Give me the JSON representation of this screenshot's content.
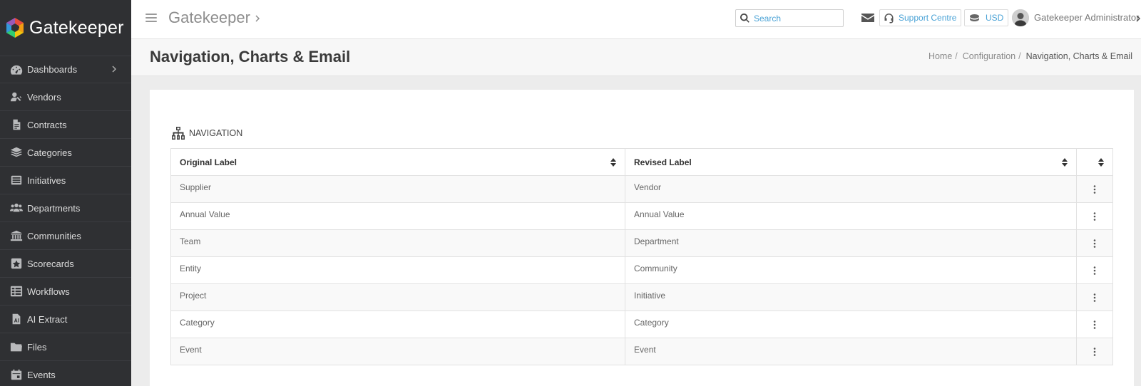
{
  "app": {
    "name": "Gatekeeper",
    "title": "Gatekeeper"
  },
  "colors": {
    "sidebar_bg": "#2f3033",
    "link": "#4ba3d6",
    "row_alt": "#f9f9f9"
  },
  "sidebar": {
    "items": [
      {
        "label": "Dashboards",
        "icon": "dashboard-icon",
        "has_submenu": true
      },
      {
        "label": "Vendors",
        "icon": "vendors-icon"
      },
      {
        "label": "Contracts",
        "icon": "contract-icon"
      },
      {
        "label": "Categories",
        "icon": "layers-icon"
      },
      {
        "label": "Initiatives",
        "icon": "initiatives-icon"
      },
      {
        "label": "Departments",
        "icon": "users-icon"
      },
      {
        "label": "Communities",
        "icon": "institution-icon"
      },
      {
        "label": "Scorecards",
        "icon": "star-icon"
      },
      {
        "label": "Workflows",
        "icon": "workflow-icon"
      },
      {
        "label": "AI Extract",
        "icon": "ai-extract-icon"
      },
      {
        "label": "Files",
        "icon": "folder-icon"
      },
      {
        "label": "Events",
        "icon": "calendar-icon"
      }
    ]
  },
  "topbar": {
    "search_placeholder": "Search",
    "support_label": "Support Centre",
    "currency_label": "USD",
    "user_name": "Gatekeeper Administrator"
  },
  "page": {
    "title": "Navigation, Charts & Email",
    "breadcrumb": [
      "Home",
      "Configuration",
      "Navigation, Charts & Email"
    ]
  },
  "navigation": {
    "section_title": "NAVIGATION",
    "columns": [
      "Original Label",
      "Revised Label"
    ],
    "rows": [
      {
        "original": "Supplier",
        "revised": "Vendor"
      },
      {
        "original": "Annual Value",
        "revised": "Annual Value"
      },
      {
        "original": "Team",
        "revised": "Department"
      },
      {
        "original": "Entity",
        "revised": "Community"
      },
      {
        "original": "Project",
        "revised": "Initiative"
      },
      {
        "original": "Category",
        "revised": "Category"
      },
      {
        "original": "Event",
        "revised": "Event"
      }
    ]
  }
}
